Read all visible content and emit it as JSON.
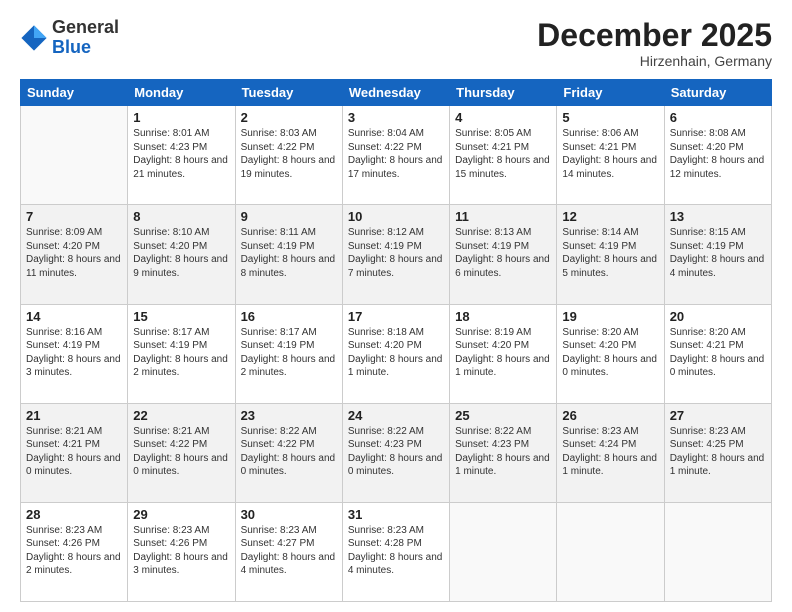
{
  "header": {
    "logo_line1": "General",
    "logo_line2": "Blue",
    "month": "December 2025",
    "location": "Hirzenhain, Germany"
  },
  "days_of_week": [
    "Sunday",
    "Monday",
    "Tuesday",
    "Wednesday",
    "Thursday",
    "Friday",
    "Saturday"
  ],
  "weeks": [
    [
      {
        "num": "",
        "sunrise": "",
        "sunset": "",
        "daylight": ""
      },
      {
        "num": "1",
        "sunrise": "Sunrise: 8:01 AM",
        "sunset": "Sunset: 4:23 PM",
        "daylight": "Daylight: 8 hours and 21 minutes."
      },
      {
        "num": "2",
        "sunrise": "Sunrise: 8:03 AM",
        "sunset": "Sunset: 4:22 PM",
        "daylight": "Daylight: 8 hours and 19 minutes."
      },
      {
        "num": "3",
        "sunrise": "Sunrise: 8:04 AM",
        "sunset": "Sunset: 4:22 PM",
        "daylight": "Daylight: 8 hours and 17 minutes."
      },
      {
        "num": "4",
        "sunrise": "Sunrise: 8:05 AM",
        "sunset": "Sunset: 4:21 PM",
        "daylight": "Daylight: 8 hours and 15 minutes."
      },
      {
        "num": "5",
        "sunrise": "Sunrise: 8:06 AM",
        "sunset": "Sunset: 4:21 PM",
        "daylight": "Daylight: 8 hours and 14 minutes."
      },
      {
        "num": "6",
        "sunrise": "Sunrise: 8:08 AM",
        "sunset": "Sunset: 4:20 PM",
        "daylight": "Daylight: 8 hours and 12 minutes."
      }
    ],
    [
      {
        "num": "7",
        "sunrise": "Sunrise: 8:09 AM",
        "sunset": "Sunset: 4:20 PM",
        "daylight": "Daylight: 8 hours and 11 minutes."
      },
      {
        "num": "8",
        "sunrise": "Sunrise: 8:10 AM",
        "sunset": "Sunset: 4:20 PM",
        "daylight": "Daylight: 8 hours and 9 minutes."
      },
      {
        "num": "9",
        "sunrise": "Sunrise: 8:11 AM",
        "sunset": "Sunset: 4:19 PM",
        "daylight": "Daylight: 8 hours and 8 minutes."
      },
      {
        "num": "10",
        "sunrise": "Sunrise: 8:12 AM",
        "sunset": "Sunset: 4:19 PM",
        "daylight": "Daylight: 8 hours and 7 minutes."
      },
      {
        "num": "11",
        "sunrise": "Sunrise: 8:13 AM",
        "sunset": "Sunset: 4:19 PM",
        "daylight": "Daylight: 8 hours and 6 minutes."
      },
      {
        "num": "12",
        "sunrise": "Sunrise: 8:14 AM",
        "sunset": "Sunset: 4:19 PM",
        "daylight": "Daylight: 8 hours and 5 minutes."
      },
      {
        "num": "13",
        "sunrise": "Sunrise: 8:15 AM",
        "sunset": "Sunset: 4:19 PM",
        "daylight": "Daylight: 8 hours and 4 minutes."
      }
    ],
    [
      {
        "num": "14",
        "sunrise": "Sunrise: 8:16 AM",
        "sunset": "Sunset: 4:19 PM",
        "daylight": "Daylight: 8 hours and 3 minutes."
      },
      {
        "num": "15",
        "sunrise": "Sunrise: 8:17 AM",
        "sunset": "Sunset: 4:19 PM",
        "daylight": "Daylight: 8 hours and 2 minutes."
      },
      {
        "num": "16",
        "sunrise": "Sunrise: 8:17 AM",
        "sunset": "Sunset: 4:19 PM",
        "daylight": "Daylight: 8 hours and 2 minutes."
      },
      {
        "num": "17",
        "sunrise": "Sunrise: 8:18 AM",
        "sunset": "Sunset: 4:20 PM",
        "daylight": "Daylight: 8 hours and 1 minute."
      },
      {
        "num": "18",
        "sunrise": "Sunrise: 8:19 AM",
        "sunset": "Sunset: 4:20 PM",
        "daylight": "Daylight: 8 hours and 1 minute."
      },
      {
        "num": "19",
        "sunrise": "Sunrise: 8:20 AM",
        "sunset": "Sunset: 4:20 PM",
        "daylight": "Daylight: 8 hours and 0 minutes."
      },
      {
        "num": "20",
        "sunrise": "Sunrise: 8:20 AM",
        "sunset": "Sunset: 4:21 PM",
        "daylight": "Daylight: 8 hours and 0 minutes."
      }
    ],
    [
      {
        "num": "21",
        "sunrise": "Sunrise: 8:21 AM",
        "sunset": "Sunset: 4:21 PM",
        "daylight": "Daylight: 8 hours and 0 minutes."
      },
      {
        "num": "22",
        "sunrise": "Sunrise: 8:21 AM",
        "sunset": "Sunset: 4:22 PM",
        "daylight": "Daylight: 8 hours and 0 minutes."
      },
      {
        "num": "23",
        "sunrise": "Sunrise: 8:22 AM",
        "sunset": "Sunset: 4:22 PM",
        "daylight": "Daylight: 8 hours and 0 minutes."
      },
      {
        "num": "24",
        "sunrise": "Sunrise: 8:22 AM",
        "sunset": "Sunset: 4:23 PM",
        "daylight": "Daylight: 8 hours and 0 minutes."
      },
      {
        "num": "25",
        "sunrise": "Sunrise: 8:22 AM",
        "sunset": "Sunset: 4:23 PM",
        "daylight": "Daylight: 8 hours and 1 minute."
      },
      {
        "num": "26",
        "sunrise": "Sunrise: 8:23 AM",
        "sunset": "Sunset: 4:24 PM",
        "daylight": "Daylight: 8 hours and 1 minute."
      },
      {
        "num": "27",
        "sunrise": "Sunrise: 8:23 AM",
        "sunset": "Sunset: 4:25 PM",
        "daylight": "Daylight: 8 hours and 1 minute."
      }
    ],
    [
      {
        "num": "28",
        "sunrise": "Sunrise: 8:23 AM",
        "sunset": "Sunset: 4:26 PM",
        "daylight": "Daylight: 8 hours and 2 minutes."
      },
      {
        "num": "29",
        "sunrise": "Sunrise: 8:23 AM",
        "sunset": "Sunset: 4:26 PM",
        "daylight": "Daylight: 8 hours and 3 minutes."
      },
      {
        "num": "30",
        "sunrise": "Sunrise: 8:23 AM",
        "sunset": "Sunset: 4:27 PM",
        "daylight": "Daylight: 8 hours and 4 minutes."
      },
      {
        "num": "31",
        "sunrise": "Sunrise: 8:23 AM",
        "sunset": "Sunset: 4:28 PM",
        "daylight": "Daylight: 8 hours and 4 minutes."
      },
      {
        "num": "",
        "sunrise": "",
        "sunset": "",
        "daylight": ""
      },
      {
        "num": "",
        "sunrise": "",
        "sunset": "",
        "daylight": ""
      },
      {
        "num": "",
        "sunrise": "",
        "sunset": "",
        "daylight": ""
      }
    ]
  ]
}
